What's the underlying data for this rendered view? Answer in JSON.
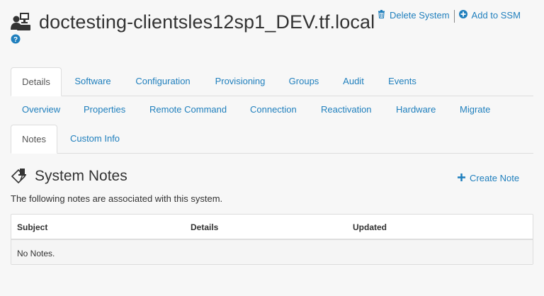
{
  "system": {
    "title": "doctesting-clientsles12sp1_DEV.tf.local",
    "icons": {
      "system": "system-icon",
      "help": "help-icon"
    }
  },
  "header_actions": {
    "delete_label": "Delete System",
    "add_ssm_label": "Add to SSM"
  },
  "tabs": [
    "Details",
    "Software",
    "Configuration",
    "Provisioning",
    "Groups",
    "Audit",
    "Events"
  ],
  "active_tab": "Details",
  "subtabs": [
    "Overview",
    "Properties",
    "Remote Command",
    "Connection",
    "Reactivation",
    "Hardware",
    "Migrate"
  ],
  "subtabs2": [
    "Notes",
    "Custom Info"
  ],
  "active_subtab2": "Notes",
  "section": {
    "title": "System Notes",
    "create_label": "Create Note",
    "description": "The following notes are associated with this system."
  },
  "table": {
    "columns": [
      "Subject",
      "Details",
      "Updated"
    ],
    "empty_message": "No Notes."
  },
  "colors": {
    "link": "#1f7fbd",
    "text": "#333333",
    "background": "#f7f7f7",
    "border": "#dddddd"
  }
}
